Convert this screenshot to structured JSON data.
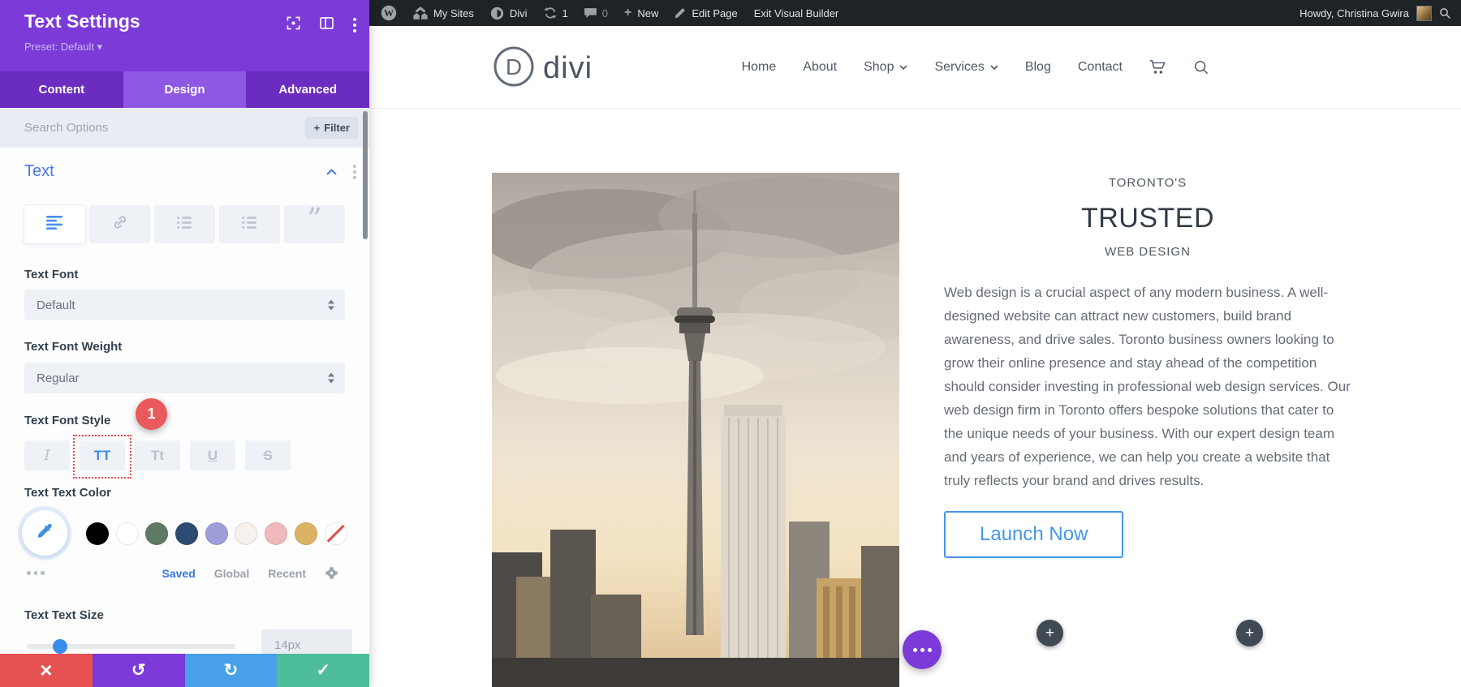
{
  "admin_bar": {
    "my_sites": "My Sites",
    "divi": "Divi",
    "updates_count": "1",
    "comments_count": "0",
    "new_label": "New",
    "edit_page": "Edit Page",
    "exit_builder": "Exit Visual Builder",
    "howdy": "Howdy, Christina Gwira"
  },
  "panel": {
    "title": "Text Settings",
    "preset_label": "Preset: Default",
    "tabs": {
      "content": "Content",
      "design": "Design",
      "advanced": "Advanced"
    },
    "active_tab": "Design",
    "search_placeholder": "Search Options",
    "filter_label": "Filter",
    "section_title": "Text",
    "text_font": {
      "label": "Text Font",
      "value": "Default"
    },
    "text_font_weight": {
      "label": "Text Font Weight",
      "value": "Regular"
    },
    "text_font_style": {
      "label": "Text Font Style",
      "badge": "1",
      "italic": "I",
      "uppercase": "TT",
      "smallcaps": "Tt",
      "underline": "U",
      "strikethrough": "S",
      "selected": "uppercase"
    },
    "text_color": {
      "label": "Text Text Color",
      "swatches": [
        "#000000",
        "#ffffff",
        "#5e7a64",
        "#2d4a72",
        "#9f9edb",
        "#f6f1ed",
        "#f2b9bc",
        "#dcb266",
        "none"
      ],
      "tabs": {
        "saved": "Saved",
        "global": "Global",
        "recent": "Recent"
      },
      "active_tab": "Saved"
    },
    "text_size": {
      "label": "Text Text Size",
      "value": "14px"
    }
  },
  "site": {
    "logo_text": "divi",
    "nav": {
      "home": "Home",
      "about": "About",
      "shop": "Shop",
      "services": "Services",
      "blog": "Blog",
      "contact": "Contact"
    },
    "hero": {
      "eyebrow": "TORONTO'S",
      "heading": "TRUSTED",
      "subheading": "WEB DESIGN",
      "body": "Web design is a crucial aspect of any modern business. A well-designed website can attract new customers, build brand awareness, and drive sales. Toronto business owners looking to grow their online presence and stay ahead of the competition should consider investing in professional web design services. Our web design firm in Toronto offers bespoke solutions that cater to the unique needs of your business. With our expert design team and years of experience, we can help you create a website that truly reflects your brand and drives results.",
      "cta": "Launch Now"
    }
  },
  "icons": {
    "plus": "+",
    "caret_down": "▾",
    "quote": "”",
    "close": "×",
    "undo": "↺",
    "redo": "↻",
    "check": "✓"
  },
  "colors": {
    "builder_purple": "#7c3ad8",
    "builder_purple_dark": "#6b2dc0",
    "builder_purple_light": "#8f58e2",
    "accent_blue": "#3a8de8",
    "badge_red": "#ea5a5c",
    "admin_bar_bg": "#1d2327",
    "footer_buttons": {
      "discard": "#e65252",
      "undo": "#7c3ad8",
      "redo": "#47a0e8",
      "save": "#4dbd9b"
    },
    "cta_blue": "#4596e8"
  }
}
